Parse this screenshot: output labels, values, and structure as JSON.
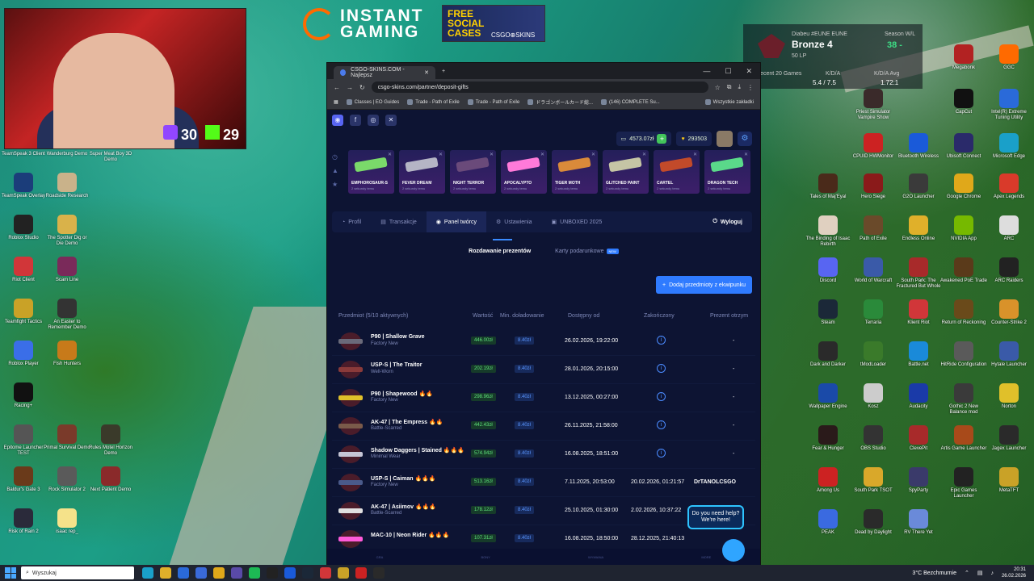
{
  "webcam": {
    "twitch_count": "30",
    "kick_count": "29"
  },
  "sponsor": {
    "name_line1": "INSTANT",
    "name_line2": "GAMING",
    "promo_line": "FREE SOCIAL CASES",
    "promo_site": "CSGO⊕SKINS"
  },
  "lol": {
    "name": "Diabeu #EUNE",
    "region": "EUNE",
    "rank": "Bronze 4",
    "lp": "50 LP",
    "season_label": "Season W/L",
    "season": "38 - ",
    "recent_label": "Recent 20 Games",
    "kda_label": "K/D/A",
    "kda": "5.4 / 7.5",
    "kda_avg_label": "K/D/A Avg",
    "kda_avg": "1.72:1"
  },
  "desktop_left": [
    {
      "label": "TeamSpeak 3 Client",
      "color": "#2a5fa8"
    },
    {
      "label": "Wanderburg Demo",
      "color": "#6b4a2a"
    },
    {
      "label": "Super Meat Boy 3D Demo",
      "color": "#b22222"
    },
    {
      "label": "TeamSpeak Overlay",
      "color": "#1b3d7a"
    },
    {
      "label": "Roadside Research",
      "color": "#c9b28a"
    },
    {
      "label": "Roblox Studio",
      "color": "#222"
    },
    {
      "label": "The Spotter Dig or Die Demo",
      "color": "#d9b24a"
    },
    {
      "label": "Riot Client",
      "color": "#d13639"
    },
    {
      "label": "Scam Line",
      "color": "#7a2a5a"
    },
    {
      "label": "Teamfight Tactics",
      "color": "#c9a227"
    },
    {
      "label": "An Easter to Remember Demo",
      "color": "#333"
    },
    {
      "label": "Roblox Player",
      "color": "#3a6ee8"
    },
    {
      "label": "Fish Hunters",
      "color": "#c77a1a"
    },
    {
      "label": "Racing+",
      "color": "#111"
    },
    {
      "label": "Epitome Launcher TEST",
      "color": "#555"
    },
    {
      "label": "Primal Survival Demo",
      "color": "#7a3a2a"
    },
    {
      "label": "Rules Motel Horizon Demo",
      "color": "#3a3a2a"
    },
    {
      "label": "Baldur's Gate 3",
      "color": "#6a3a1a"
    },
    {
      "label": "Rock Simulator 2",
      "color": "#5a5a5a"
    },
    {
      "label": "Next Patient Demo",
      "color": "#8a2a2a"
    },
    {
      "label": "Risk of Rain 2",
      "color": "#2a2a3a"
    },
    {
      "label": "isaac rep_",
      "color": "#f5e28a"
    }
  ],
  "desktop_right": [
    {
      "label": "Megabonk",
      "color": "#b22222"
    },
    {
      "label": "GGC",
      "color": "#ff6a00"
    },
    {
      "label": "CapCut",
      "color": "#111"
    },
    {
      "label": "Intel(R) Extreme Tuning Utility",
      "color": "#2a6ad9"
    },
    {
      "label": "Priest Simulator Vampire Show",
      "color": "#3a2a2a"
    },
    {
      "label": "CPUID HWMonitor",
      "color": "#c22"
    },
    {
      "label": "Bluetooth Wireless",
      "color": "#1a5ad9"
    },
    {
      "label": "Ubisoft Connect",
      "color": "#2a2a6a"
    },
    {
      "label": "Microsoft Edge",
      "color": "#1aa0c9"
    },
    {
      "label": "Tales of Maj'Eyal",
      "color": "#4a2a1a"
    },
    {
      "label": "Hero Siege",
      "color": "#8a1a1a"
    },
    {
      "label": "G2O Launcher",
      "color": "#3a3a3a"
    },
    {
      "label": "Google Chrome",
      "color": "#e0a81a"
    },
    {
      "label": "Apex Legends",
      "color": "#d93a2a"
    },
    {
      "label": "The Binding of Isaac Rebirth",
      "color": "#e0d0c0"
    },
    {
      "label": "Path of Exile",
      "color": "#6a4a2a"
    },
    {
      "label": "Endless Online",
      "color": "#e0b02a"
    },
    {
      "label": "NVIDIA App",
      "color": "#76b900"
    },
    {
      "label": "ARC",
      "color": "#ddd"
    },
    {
      "label": "Discord",
      "color": "#5865f2"
    },
    {
      "label": "World of Warcraft",
      "color": "#3a5aa8"
    },
    {
      "label": "South Park: The Fractured But Whole",
      "color": "#a82a2a"
    },
    {
      "label": "Awakened PoE Trade",
      "color": "#5a3a1a"
    },
    {
      "label": "ARC Raiders",
      "color": "#222"
    },
    {
      "label": "Steam",
      "color": "#1b2838"
    },
    {
      "label": "Terraria",
      "color": "#2a8a3a"
    },
    {
      "label": "Klient Riot",
      "color": "#d13639"
    },
    {
      "label": "Return of Reckoning",
      "color": "#6a4a1a"
    },
    {
      "label": "Counter-Strike 2",
      "color": "#d9922a"
    },
    {
      "label": "Dark and Darker",
      "color": "#2a2a2a"
    },
    {
      "label": "tModLoader",
      "color": "#3a7a2a"
    },
    {
      "label": "Battle.net",
      "color": "#1a8ad9"
    },
    {
      "label": "HitRide Configuration",
      "color": "#5a5a5a"
    },
    {
      "label": "Hytale Launcher",
      "color": "#3a5aa8"
    },
    {
      "label": "Wallpaper Engine",
      "color": "#1a4aa8"
    },
    {
      "label": "Kosz",
      "color": "#ccc"
    },
    {
      "label": "Audacity",
      "color": "#1a3aa8"
    },
    {
      "label": "Gothic 2 New Balance mod",
      "color": "#3a3a3a"
    },
    {
      "label": "Norton",
      "color": "#e0c02a"
    },
    {
      "label": "Fear & Hunger",
      "color": "#2a1a1a"
    },
    {
      "label": "OBS Studio",
      "color": "#333"
    },
    {
      "label": "ClevePit",
      "color": "#a82a2a"
    },
    {
      "label": "Artis Game Launcher",
      "color": "#a84a1a"
    },
    {
      "label": "Jagex Launcher",
      "color": "#2a2a2a"
    },
    {
      "label": "Among Us",
      "color": "#c22"
    },
    {
      "label": "South Park TSOT",
      "color": "#d9a82a"
    },
    {
      "label": "SpyParty",
      "color": "#3a3a6a"
    },
    {
      "label": "Epic Games Launcher",
      "color": "#222"
    },
    {
      "label": "MetaTFT",
      "color": "#c9a227"
    },
    {
      "label": "PEAK",
      "color": "#3a6ae0"
    },
    {
      "label": "Dead by Daylight",
      "color": "#2a2a2a"
    },
    {
      "label": "RV There Yet",
      "color": "#6a8ad9"
    }
  ],
  "browser": {
    "tab_title": "CSGO-SKINS.COM - Najlepsz",
    "url": "csgo-skins.com/partner/deposit-gifts",
    "bookmarks": [
      "Classes | EO Guides",
      "Trade - Path of Exile",
      "Trade - Path of Exile",
      "ドラゴンボールカード総...",
      "(146) COMPLETE Su...",
      "Wszystkie zakładki"
    ]
  },
  "site": {
    "balance": "4573.07zł",
    "coins": "293503",
    "drops": [
      {
        "name": "EMPHOROSAUR-S",
        "sub": "2 sekundy temu",
        "gun_color": "#7ad96a"
      },
      {
        "name": "FEVER DREAM",
        "sub": "2 sekundy temu",
        "gun_color": "#b5b5c5"
      },
      {
        "name": "NIGHT TERROR",
        "sub": "2 sekundy temu",
        "gun_color": "#6a4a7a"
      },
      {
        "name": "APOCALYPTO",
        "sub": "2 sekundy temu",
        "gun_color": "#ff7ad9"
      },
      {
        "name": "TIGER MOTH",
        "sub": "2 sekundy temu",
        "gun_color": "#d98a3a"
      },
      {
        "name": "GLITCHED PAINT",
        "sub": "2 sekundy temu",
        "gun_color": "#c5c5a5"
      },
      {
        "name": "CARTEL",
        "sub": "2 sekundy temu",
        "gun_color": "#c24a2a"
      },
      {
        "name": "DRAGON TECH",
        "sub": "2 sekundy temu",
        "gun_color": "#5ad98a"
      }
    ],
    "nav": {
      "profile": "Profil",
      "transactions": "Transakcje",
      "creator": "Panel twórcy",
      "settings": "Ustawienia",
      "unboxed": "UNBOXED 2025",
      "logout": "Wyloguj"
    },
    "subtabs": {
      "gifts": "Rozdawanie prezentów",
      "cards": "Karty podarunkowe",
      "new_badge": "NEW"
    },
    "add_button": "Dodaj przedmioty z ekwipunku",
    "table_headers": {
      "item": "Przedmiot (5/10 aktywnych)",
      "value": "Wartość",
      "min": "Min. doładowanie",
      "from": "Dostępny od",
      "end": "Zakończony",
      "recipient": "Prezent otrzym"
    },
    "rows": [
      {
        "name": "P90 | Shallow Grave",
        "fire": "",
        "cond": "Factory New",
        "value": "446.00zł",
        "min": "8.40zł",
        "from": "26.02.2026, 19:22:00",
        "end": "",
        "recipient": "-",
        "gun_color": "#6a6a7a"
      },
      {
        "name": "USP-S | The Traitor",
        "fire": "",
        "cond": "Well-Worn",
        "value": "202.19zł",
        "min": "8.40zł",
        "from": "28.01.2026, 20:15:00",
        "end": "",
        "recipient": "-",
        "gun_color": "#8a3a3a"
      },
      {
        "name": "P90 | Shapewood",
        "fire": "🔥🔥",
        "cond": "Factory New",
        "value": "298.96zł",
        "min": "8.40zł",
        "from": "13.12.2025, 00:27:00",
        "end": "",
        "recipient": "-",
        "gun_color": "#e0c02a"
      },
      {
        "name": "AK-47 | The Empress",
        "fire": "🔥🔥",
        "cond": "Battle-Scarred",
        "value": "442.43zł",
        "min": "8.40zł",
        "from": "26.11.2025, 21:58:00",
        "end": "",
        "recipient": "-",
        "gun_color": "#7a5a4a"
      },
      {
        "name": "Shadow Daggers | Stained",
        "fire": "🔥🔥🔥",
        "cond": "Minimal Wear",
        "value": "574.94zł",
        "min": "8.40zł",
        "from": "16.08.2025, 18:51:00",
        "end": "",
        "recipient": "-",
        "gun_color": "#c5c5d5"
      },
      {
        "name": "USP-S | Caiman",
        "fire": "🔥🔥🔥",
        "cond": "Factory New",
        "value": "513.16zł",
        "min": "8.40zł",
        "from": "7.11.2025, 20:53:00",
        "end": "20.02.2026, 01:21:57",
        "recipient": "DrTANOLCSGO",
        "gun_color": "#4a5a8a"
      },
      {
        "name": "AK-47 | Asiimov",
        "fire": "🔥🔥🔥",
        "cond": "Battle-Scarred",
        "value": "178.12zł",
        "min": "8.40zł",
        "from": "25.10.2025, 01:30:00",
        "end": "2.02.2026, 10:37:22",
        "recipient": "",
        "gun_color": "#e0e0e0"
      },
      {
        "name": "MAC-10 | Neon Rider",
        "fire": "🔥🔥🔥",
        "cond": "",
        "value": "107.31zł",
        "min": "8.40zł",
        "from": "16.08.2025, 18:50:00",
        "end": "28.12.2025, 21:40:13",
        "recipient": "",
        "gun_color": "#ff5ad9"
      }
    ],
    "help": {
      "line1": "Do you need help?",
      "line2": "We're here!"
    },
    "bottom_nav": [
      "GRA",
      "BONY",
      "WYMIANA",
      "MORE"
    ]
  },
  "taskbar": {
    "search_placeholder": "Wyszukaj",
    "weather": "3°C Bezchmurnie",
    "time": "20:31",
    "date": "26.02.2026"
  }
}
